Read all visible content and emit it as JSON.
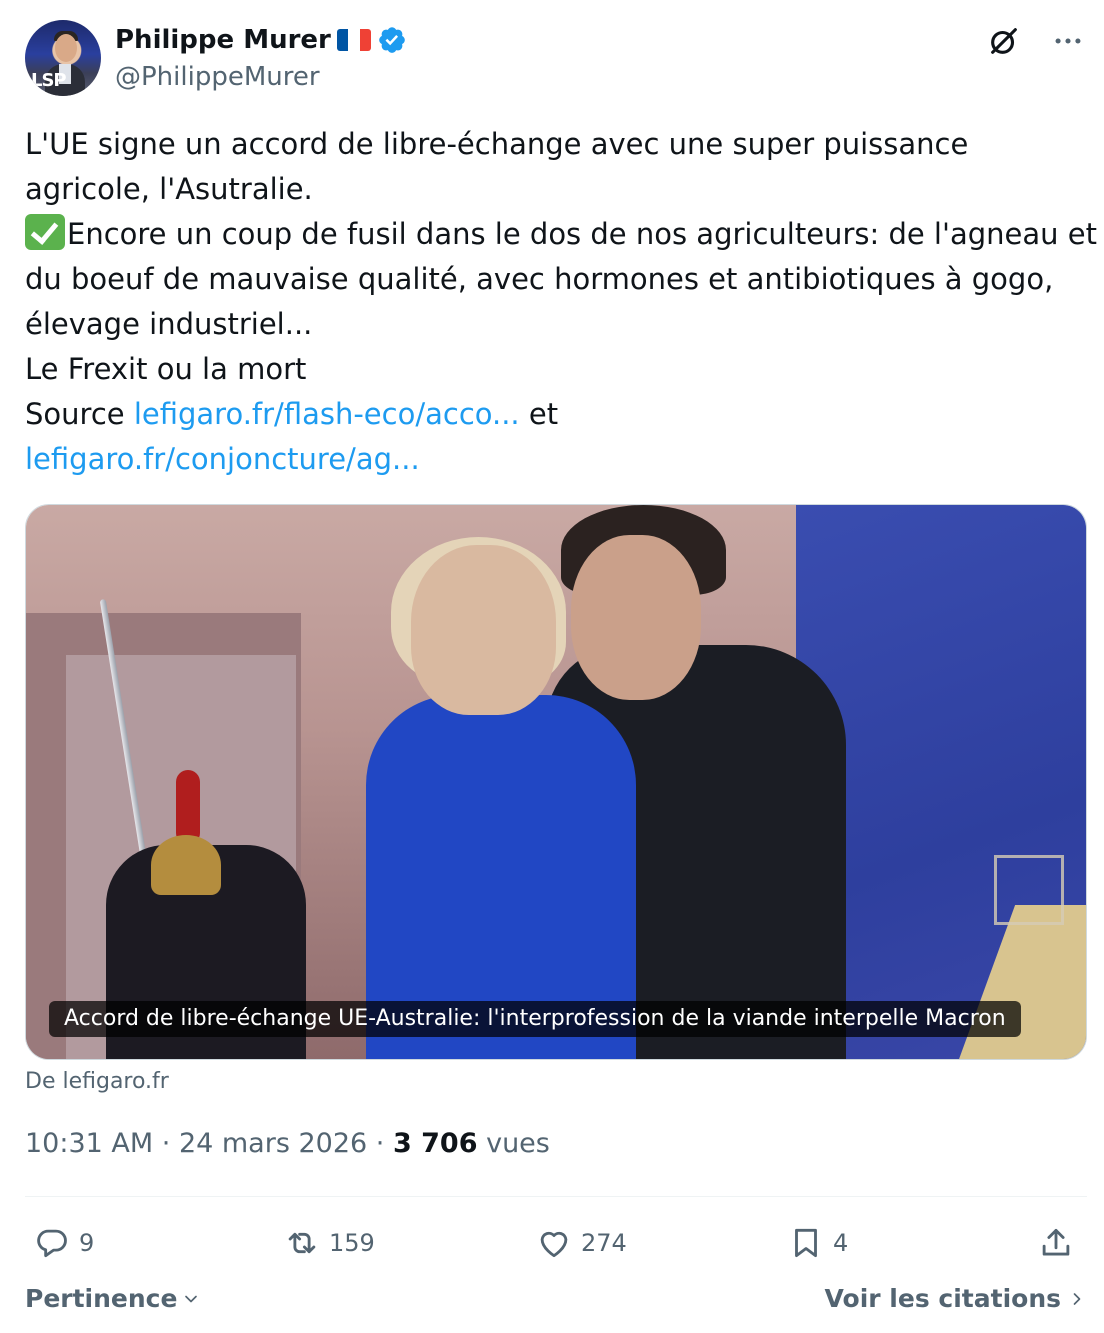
{
  "author": {
    "name": "Philippe Murer",
    "handle": "@PhilippeMurer",
    "flag_colors": [
      "#0055a4",
      "#ffffff",
      "#ef4135"
    ],
    "verified_color": "#1d9bf0",
    "avatar_logo": "LSP"
  },
  "header_icons": {
    "grok": "grok-icon",
    "more": "more-icon"
  },
  "tweet": {
    "line1": "L'UE signe un accord de libre-échange avec une super puissance",
    "line2": "agricole, l'Asutralie.",
    "line3": "Encore un coup de fusil dans le dos de nos agriculteurs: de l'agneau et",
    "line4": "du boeuf de mauvaise qualité, avec hormones et antibiotiques à gogo,",
    "line5": "élevage industriel...",
    "line6": "Le Frexit ou la mort",
    "source_label": "Source",
    "link1": "lefigaro.fr/flash-eco/acco...",
    "link_joiner": "et",
    "link2": "lefigaro.fr/conjoncture/ag...",
    "link_color": "#1d9bf0"
  },
  "media": {
    "caption": "Accord de libre-échange UE-Australie: l'interprofession de la viande interpelle Macron",
    "source": "De lefigaro.fr"
  },
  "meta": {
    "time": "10:31 AM",
    "date": "24 mars 2026",
    "views_count": "3 706",
    "views_label": "vues"
  },
  "actions": {
    "replies": "9",
    "reposts": "159",
    "likes": "274",
    "bookmarks": "4"
  },
  "footer": {
    "sort_label": "Pertinence",
    "quotes_label": "Voir les citations"
  }
}
